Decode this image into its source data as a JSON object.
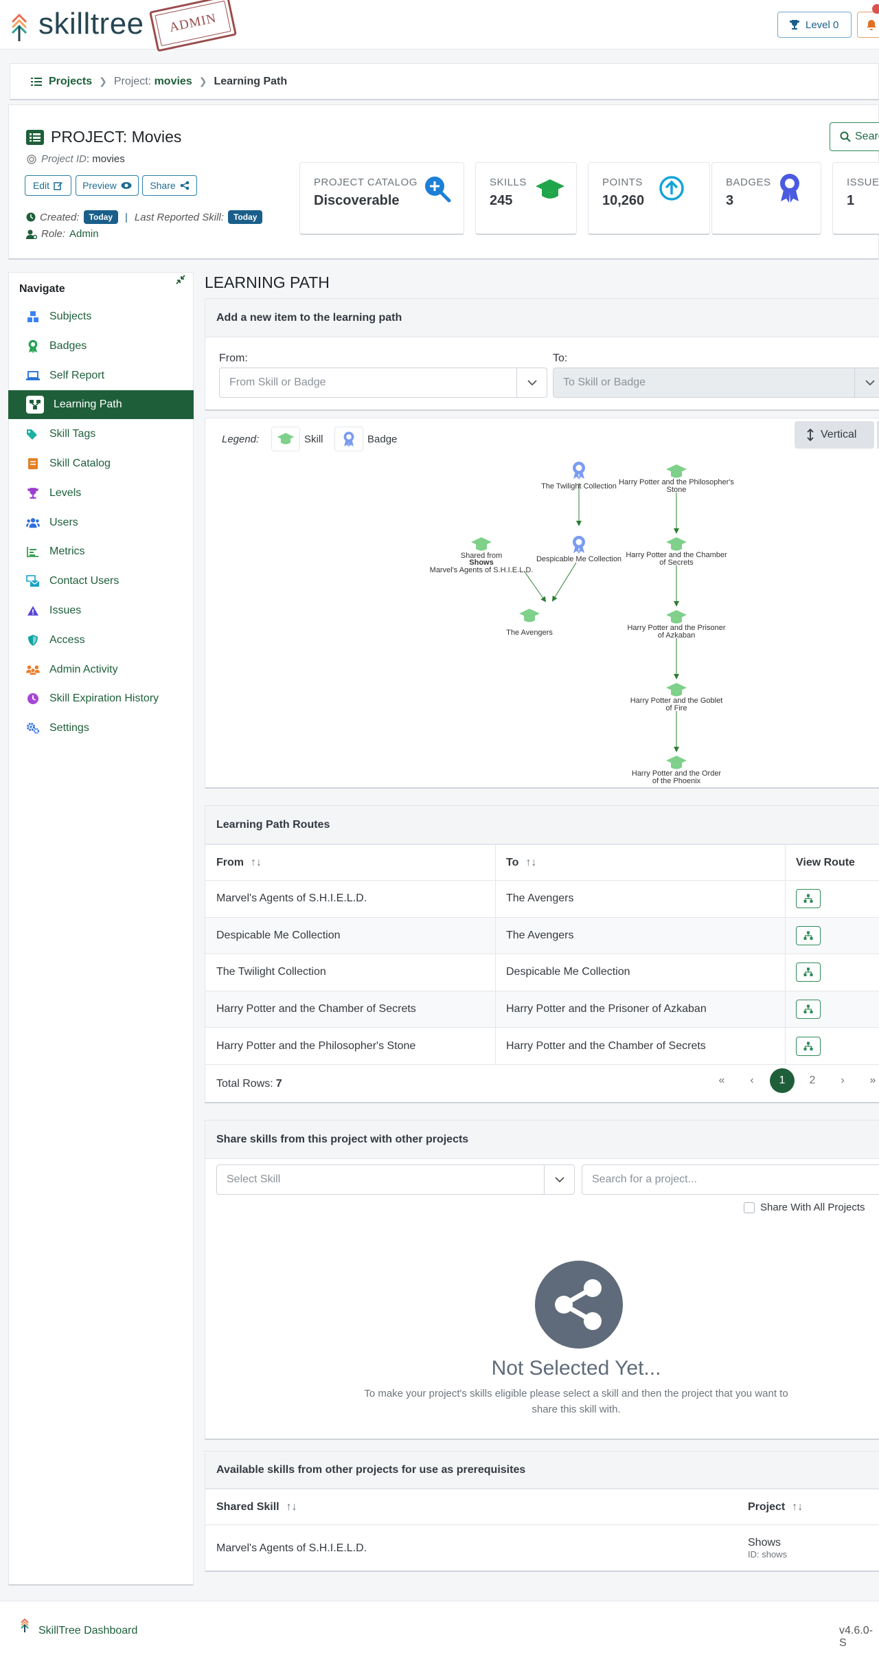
{
  "header": {
    "logo_text": "skilltree",
    "admin_stamp": "ADMIN",
    "level_button": "Level 0"
  },
  "breadcrumb": {
    "projects": "Projects",
    "project_prefix": "Project:",
    "project_name": "movies",
    "current": "Learning Path"
  },
  "project": {
    "title": "PROJECT: Movies",
    "id_label": "Project ID",
    "id_value": ": movies",
    "edit_label": "Edit",
    "preview_label": "Preview",
    "share_label": "Share",
    "created_label": "Created:",
    "created_value": "Today",
    "last_reported_label": "Last Reported Skill:",
    "last_reported_value": "Today",
    "role_label": "Role:",
    "role_value": "Admin",
    "search_label": "Searc"
  },
  "stats": {
    "catalog": {
      "label": "PROJECT CATALOG",
      "value": "Discoverable"
    },
    "skills": {
      "label": "SKILLS",
      "value": "245"
    },
    "points": {
      "label": "POINTS",
      "value": "10,260"
    },
    "badges": {
      "label": "BADGES",
      "value": "3"
    },
    "issues": {
      "label": "ISSUES",
      "value": "1"
    }
  },
  "sidebar": {
    "title": "Navigate",
    "items": [
      {
        "label": "Subjects",
        "icon": "cubes-icon",
        "color": "#3b82f6"
      },
      {
        "label": "Badges",
        "icon": "award-icon",
        "color": "#22a355"
      },
      {
        "label": "Self Report",
        "icon": "laptop-icon",
        "color": "#1d6fd1"
      },
      {
        "label": "Learning Path",
        "icon": "network-icon",
        "color": "#1e5f3a"
      },
      {
        "label": "Skill Tags",
        "icon": "tags-icon",
        "color": "#1eb0a0"
      },
      {
        "label": "Skill Catalog",
        "icon": "book-icon",
        "color": "#e67e22"
      },
      {
        "label": "Levels",
        "icon": "trophy-icon",
        "color": "#9b3fd1"
      },
      {
        "label": "Users",
        "icon": "users-icon",
        "color": "#2f6ee0"
      },
      {
        "label": "Metrics",
        "icon": "chart-icon",
        "color": "#2e9e4a"
      },
      {
        "label": "Contact Users",
        "icon": "mail-bulk-icon",
        "color": "#1aa1c4"
      },
      {
        "label": "Issues",
        "icon": "warning-icon",
        "color": "#5b4ad6"
      },
      {
        "label": "Access",
        "icon": "shield-icon",
        "color": "#11a4a0"
      },
      {
        "label": "Admin Activity",
        "icon": "people-icon",
        "color": "#ee7b2a"
      },
      {
        "label": "Skill Expiration History",
        "icon": "clock-icon",
        "color": "#a646d6"
      },
      {
        "label": "Settings",
        "icon": "cogs-icon",
        "color": "#2f6ee0"
      }
    ]
  },
  "main": {
    "page_title": "LEARNING PATH",
    "add_item": {
      "title": "Add a new item to the learning path",
      "from_label": "From:",
      "from_placeholder": "From Skill or Badge",
      "to_label": "To:",
      "to_placeholder": "To Skill or Badge"
    },
    "graph": {
      "legend_label": "Legend:",
      "legend_skill": "Skill",
      "legend_badge": "Badge",
      "orientation_button": "Vertical",
      "nodes": [
        {
          "id": "twilight",
          "type": "badge",
          "label": "The Twilight Collection"
        },
        {
          "id": "despicable",
          "type": "badge",
          "label": "Despicable Me Collection"
        },
        {
          "id": "shield",
          "type": "skill",
          "label_1": "Shared from",
          "label_2": "Shows",
          "label_3": "Marvel's Agents of S.H.I.E.L.D."
        },
        {
          "id": "avengers",
          "type": "skill",
          "label": "The Avengers"
        },
        {
          "id": "hp1",
          "type": "skill",
          "label_1": "Harry Potter and the Philosopher's",
          "label_2": "Stone"
        },
        {
          "id": "hp2",
          "type": "skill",
          "label_1": "Harry Potter and the Chamber",
          "label_2": "of Secrets"
        },
        {
          "id": "hp3",
          "type": "skill",
          "label_1": "Harry Potter and the Prisoner",
          "label_2": "of Azkaban"
        },
        {
          "id": "hp4",
          "type": "skill",
          "label_1": "Harry Potter and the Goblet",
          "label_2": "of Fire"
        },
        {
          "id": "hp5",
          "type": "skill",
          "label_1": "Harry Potter and the Order",
          "label_2": "of the Phoenix"
        }
      ]
    },
    "routes": {
      "title": "Learning Path Routes",
      "col_from": "From",
      "col_to": "To",
      "col_view": "View Route",
      "rows": [
        {
          "from": "Marvel's Agents of S.H.I.E.L.D.",
          "to": "The Avengers"
        },
        {
          "from": "Despicable Me Collection",
          "to": "The Avengers"
        },
        {
          "from": "The Twilight Collection",
          "to": "Despicable Me Collection"
        },
        {
          "from": "Harry Potter and the Chamber of Secrets",
          "to": "Harry Potter and the Prisoner of Azkaban"
        },
        {
          "from": "Harry Potter and the Philosopher's Stone",
          "to": "Harry Potter and the Chamber of Secrets"
        }
      ],
      "total_label": "Total Rows:",
      "total_value": "7",
      "pages": [
        "1",
        "2"
      ],
      "current_page": "1"
    },
    "share": {
      "title": "Share skills from this project with other projects",
      "select_skill_placeholder": "Select Skill",
      "search_project_placeholder": "Search for a project...",
      "share_all_label": "Share With All Projects",
      "empty_title": "Not Selected Yet...",
      "empty_text_1": "To make your project's skills eligible please select a skill and then the project that you want to",
      "empty_text_2": "share this skill with."
    },
    "available": {
      "title": "Available skills from other projects for use as prerequisites",
      "col_skill": "Shared Skill",
      "col_project": "Project",
      "rows": [
        {
          "skill": "Marvel's Agents of S.H.I.E.L.D.",
          "project": "Shows",
          "project_id": "ID: shows"
        }
      ]
    }
  },
  "footer": {
    "label": "SkillTree Dashboard",
    "version": "v4.6.0-S"
  },
  "colors": {
    "brand_green": "#1e5f3a",
    "skill_node": "#7fd08a",
    "badge_node": "#7a9cf0",
    "accent_blue": "#1a5f8a"
  }
}
